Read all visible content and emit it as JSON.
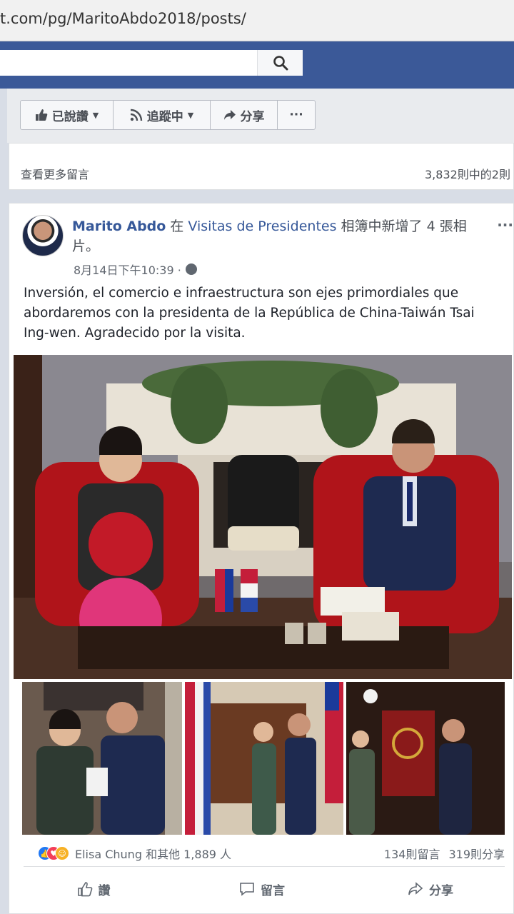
{
  "browser": {
    "url": "t.com/pg/MaritoAbdo2018/posts/"
  },
  "header": {
    "search_icon": "search-icon"
  },
  "page_actions": {
    "liked_label": "已說讚",
    "following_label": "追蹤中",
    "share_label": "分享",
    "more_label": "···"
  },
  "comments_card": {
    "view_more": "查看更多留言",
    "count": "3,832則中的2則"
  },
  "post": {
    "author": "Marito Abdo",
    "connector": " 在 ",
    "album": "Visitas de Presidentes",
    "action_text": " 相簿中新增了 4 張相片。",
    "timestamp": "8月14日下午10:39 ·",
    "more": "···",
    "text": "Inversión, el comercio e infraestructura son ejes primordiales que abordaremos con la presidenta de la República de China-Taiwán Tsai Ing-wen. Agradecido por la visita.",
    "reactions_text": "Elisa Chung 和其他 1,889 人",
    "comments_count": "134則留言",
    "shares_count": "319則分享",
    "like_label": "讚",
    "comment_label": "留言",
    "share_label": "分享"
  },
  "colors": {
    "fb_blue": "#3b5998",
    "link_blue": "#365899",
    "text_gray": "#606770"
  }
}
